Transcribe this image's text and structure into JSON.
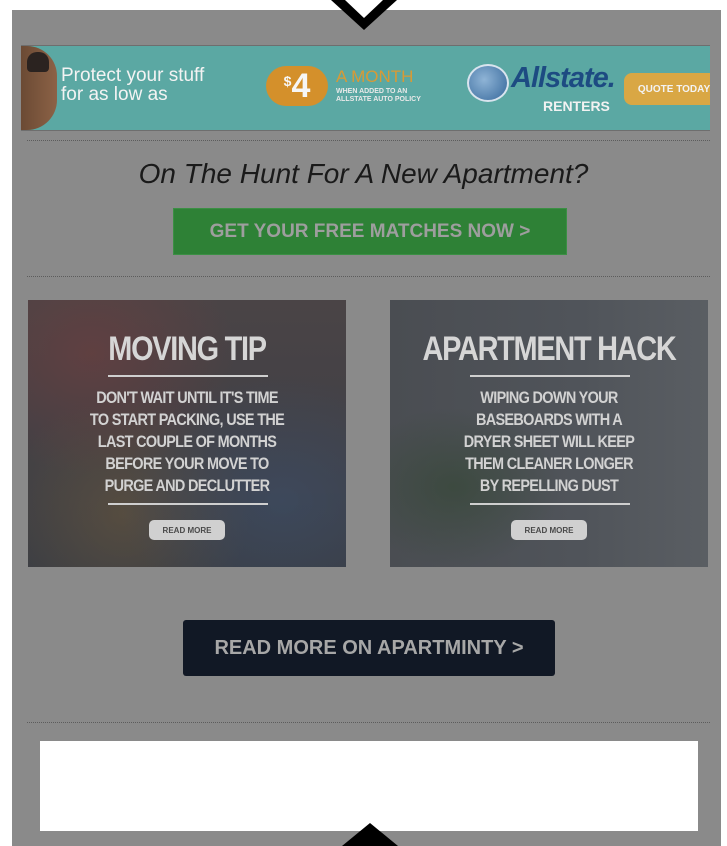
{
  "ad": {
    "line1": "Protect your stuff",
    "line2": "for as low as",
    "price_symbol": "$",
    "price_value": "4",
    "period": "A MONTH",
    "sub_line1": "WHEN ADDED TO AN",
    "sub_line2": "ALLSTATE AUTO POLICY",
    "brand": "Allstate.",
    "product": "RENTERS",
    "cta": "QUOTE TODAY"
  },
  "headline": "On The Hunt For A New Apartment?",
  "primary_cta": "GET YOUR FREE MATCHES NOW >",
  "cards": [
    {
      "title": "MOVING TIP",
      "body": "DON'T WAIT UNTIL IT'S TIME\nTO START PACKING, USE THE\nLAST COUPLE OF MONTHS\nBEFORE YOUR MOVE TO\nPURGE AND DECLUTTER",
      "button": "READ MORE"
    },
    {
      "title": "APARTMENT HACK",
      "body": "WIPING DOWN YOUR\nBASEBOARDS WITH A\nDRYER SHEET WILL KEEP\nTHEM CLEANER LONGER\nBY REPELLING DUST",
      "button": "READ MORE"
    }
  ],
  "secondary_cta": "READ MORE ON APARTMINTY >",
  "colors": {
    "overlay": "#8a8a8a",
    "ad_bg": "#5ba8a3",
    "green_button": "#2e8136",
    "dark_button": "#111825"
  },
  "icons": {
    "top": "arrow-down-icon",
    "bottom": "arrow-up-icon"
  }
}
